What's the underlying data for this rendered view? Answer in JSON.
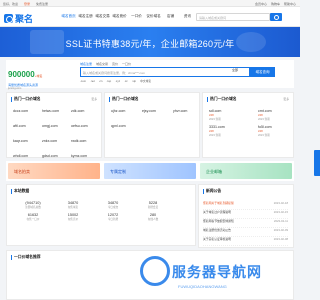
{
  "topbar": {
    "welcome": "您好，欢迎",
    "login": "登录",
    "register": "免费注册",
    "links": [
      "会员中心",
      "购物车",
      "帮助中心"
    ]
  },
  "nav": {
    "logo": "聚名",
    "menu": [
      "域名首页",
      "域名注册",
      "域名交易",
      "域名竞价",
      "一口价",
      "议价域名",
      "店铺",
      "资讯",
      "工具"
    ],
    "active_index": 0,
    "search_placeholder": "请输入域名或关键词"
  },
  "banner": {
    "text": "SSL证书特惠38元/年，企业邮箱260元/年"
  },
  "promo": {
    "number": "900000",
    "unit": "+域名",
    "line1": "海量优质域名源头资源",
    "line2": "juming.com"
  },
  "search": {
    "tabs": [
      "域名注册",
      "域名交易",
      "竞价",
      "一口价"
    ],
    "active_tab": 0,
    "placeholder": "输入域名或关键词搜索注册，例：china***.com",
    "select": "全部",
    "button": "域名查询",
    "suffixes": [
      ".com",
      ".net",
      ".cn",
      ".top",
      ".xyz",
      ".cc",
      ".vip",
      "中文域名"
    ]
  },
  "hot_domains": {
    "title": "热门一口价域名",
    "more": "更多",
    "items": [
      "dccz.com",
      "heiwu.com",
      "zdk.com",
      "ujhz.com",
      "aftl.com",
      "omgj.com",
      "oefsu.com",
      "ejsy.com",
      "kaqr.com",
      "znkx.com",
      "rwdk.com",
      "yhvr.com",
      "whdl.com",
      "gdsd.com",
      "kymz.com",
      "qpnl.com"
    ]
  },
  "featured_domains": {
    "title": "热门一口价域名",
    "more": "更多",
    "items": [
      {
        "name": "sdl.com",
        "price": "¥48",
        "meta": "2023 到期"
      },
      {
        "name": "cmt.com",
        "price": "¥48",
        "meta": "2023 到期"
      },
      {
        "name": "uyeq.com",
        "price": "¥48",
        "meta": "2024 到期"
      },
      {
        "name": "yaml.com",
        "price": "¥48",
        "meta": "2023 到期"
      },
      {
        "name": "3331.com",
        "price": "¥48",
        "meta": "2023 到期"
      },
      {
        "name": "fo5l.com",
        "price": "¥48",
        "meta": "2023 到期"
      },
      {
        "name": "znnmn.com",
        "price": "¥48",
        "meta": "2023 到期"
      },
      {
        "name": "lwqd.com",
        "price": "¥48",
        "meta": "2024 到期"
      }
    ]
  },
  "ads": {
    "a1": "域名拍卖",
    "a2": "专属定制",
    "a3": "企业邮箱"
  },
  "stats": {
    "title": "本站数据",
    "items": [
      {
        "num": "(944710)",
        "label": "注册域名总数"
      },
      {
        "num": "34870",
        "label": "在售域名"
      },
      {
        "num": "34870",
        "label": "今日成交"
      },
      {
        "num": "5228",
        "label": "新增会员"
      },
      {
        "num": "61632",
        "label": "在售一口价"
      },
      {
        "num": "15002",
        "label": "在售竞价"
      },
      {
        "num": "12072",
        "label": "今日新增"
      },
      {
        "num": "280",
        "label": "在线人数"
      }
    ]
  },
  "news": {
    "title": "新闻公告",
    "items": [
      {
        "title": "聚名网关于域名到期提醒",
        "date": "2023-02-18"
      },
      {
        "title": "关于域名过户流程说明",
        "date": "2023-02-15"
      },
      {
        "title": "聚名网春节放假安排通知",
        "date": "2023-02-11"
      },
      {
        "title": "域名注册优惠活动公告",
        "date": "2023-02-09"
      },
      {
        "title": "关于实名认证审核说明",
        "date": "2023-02-08"
      },
      {
        "title": "聚名网新功能上线公告",
        "date": "2023-02-08"
      }
    ]
  },
  "bottom": {
    "title": "一口价域名推荐"
  },
  "watermark": {
    "main": "服务器导航网",
    "sub": "FUWUQIDAOHANGWANG"
  }
}
